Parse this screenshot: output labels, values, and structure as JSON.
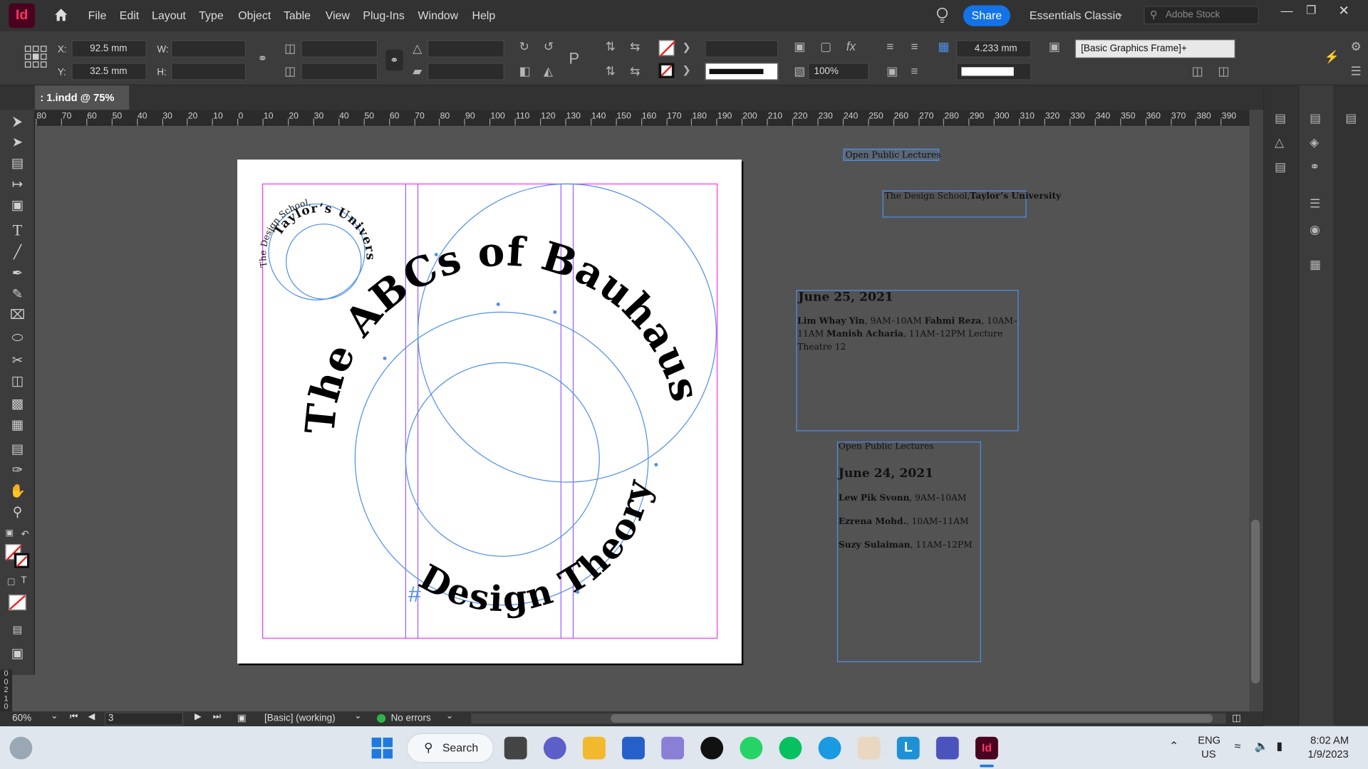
{
  "app": {
    "logo": "Id",
    "name": "Adobe InDesign"
  },
  "menu": [
    "File",
    "Edit",
    "Layout",
    "Type",
    "Object",
    "Table",
    "View",
    "Plug-Ins",
    "Window",
    "Help"
  ],
  "topbar": {
    "share": "Share",
    "workspace": "Essentials Classic",
    "stock_placeholder": "Adobe Stock"
  },
  "control": {
    "x_label": "X:",
    "x_value": "92.5 mm",
    "y_label": "Y:",
    "y_value": "32.5 mm",
    "w_label": "W:",
    "h_label": "H:",
    "stroke_weight": "4.233 mm",
    "opacity": "100%",
    "object_style": "[Basic Graphics Frame]+"
  },
  "document": {
    "tab_label": ": 1.indd @ 75%"
  },
  "ruler": {
    "ticks": [
      "80",
      "70",
      "60",
      "50",
      "40",
      "30",
      "20",
      "10",
      "0",
      "10",
      "20",
      "30",
      "40",
      "50",
      "60",
      "70",
      "80",
      "90",
      "100",
      "110",
      "120",
      "130",
      "140",
      "150",
      "160",
      "170",
      "180",
      "190",
      "200",
      "210",
      "220",
      "230",
      "240",
      "250",
      "260",
      "270",
      "280",
      "290",
      "300",
      "310",
      "320",
      "330",
      "340",
      "350",
      "360",
      "370",
      "380",
      "390"
    ]
  },
  "vruler": {
    "ticks": [
      "0",
      "0",
      "2",
      "1",
      "0"
    ]
  },
  "canvas": {
    "small_circle_line1": "The Design School,",
    "small_circle_line2": "Taylor’s University",
    "main_title": "The ABCs of Bauhaus",
    "main_subtitle": "Design Theory"
  },
  "textframes": {
    "tf1": "Open Public Lectures",
    "tf2_a": "The Design School,",
    "tf2_b": "Taylor’s University",
    "tf3_date": "June 25, 2021",
    "tf3_name1": "Lim Whay Yin",
    "tf3_time1": ", 9AM–10AM ",
    "tf3_name2": "Fahmi Reza",
    "tf3_time2": ", 10AM–11AM ",
    "tf3_name3": "Manish Acharia",
    "tf3_time3": ", 11AM–12PM Lecture Theatre 12",
    "tf4_head": "Open Public Lectures",
    "tf4_date": "June 24, 2021",
    "tf4_name1": "Lew Pik Svonn",
    "tf4_time1": ", 9AM–10AM",
    "tf4_name2": "Ezrena Mohd.",
    "tf4_time2": ", 10AM–11AM",
    "tf4_name3": "Suzy Sulaiman",
    "tf4_time3": ", 11AM–12PM"
  },
  "status": {
    "zoom": "60%",
    "page": "3",
    "preflight_profile": "[Basic] (working)",
    "errors": "No errors"
  },
  "taskbar": {
    "search": "Search",
    "lang1": "ENG",
    "lang2": "US",
    "time": "8:02 AM",
    "date": "1/9/2023"
  },
  "colors": {
    "accent": "#1473e6",
    "frame": "#4f8fe8",
    "margin": "#ff33ff",
    "column": "#9b5cff",
    "logo_bg": "#49021f",
    "logo_fg": "#ff3366"
  }
}
